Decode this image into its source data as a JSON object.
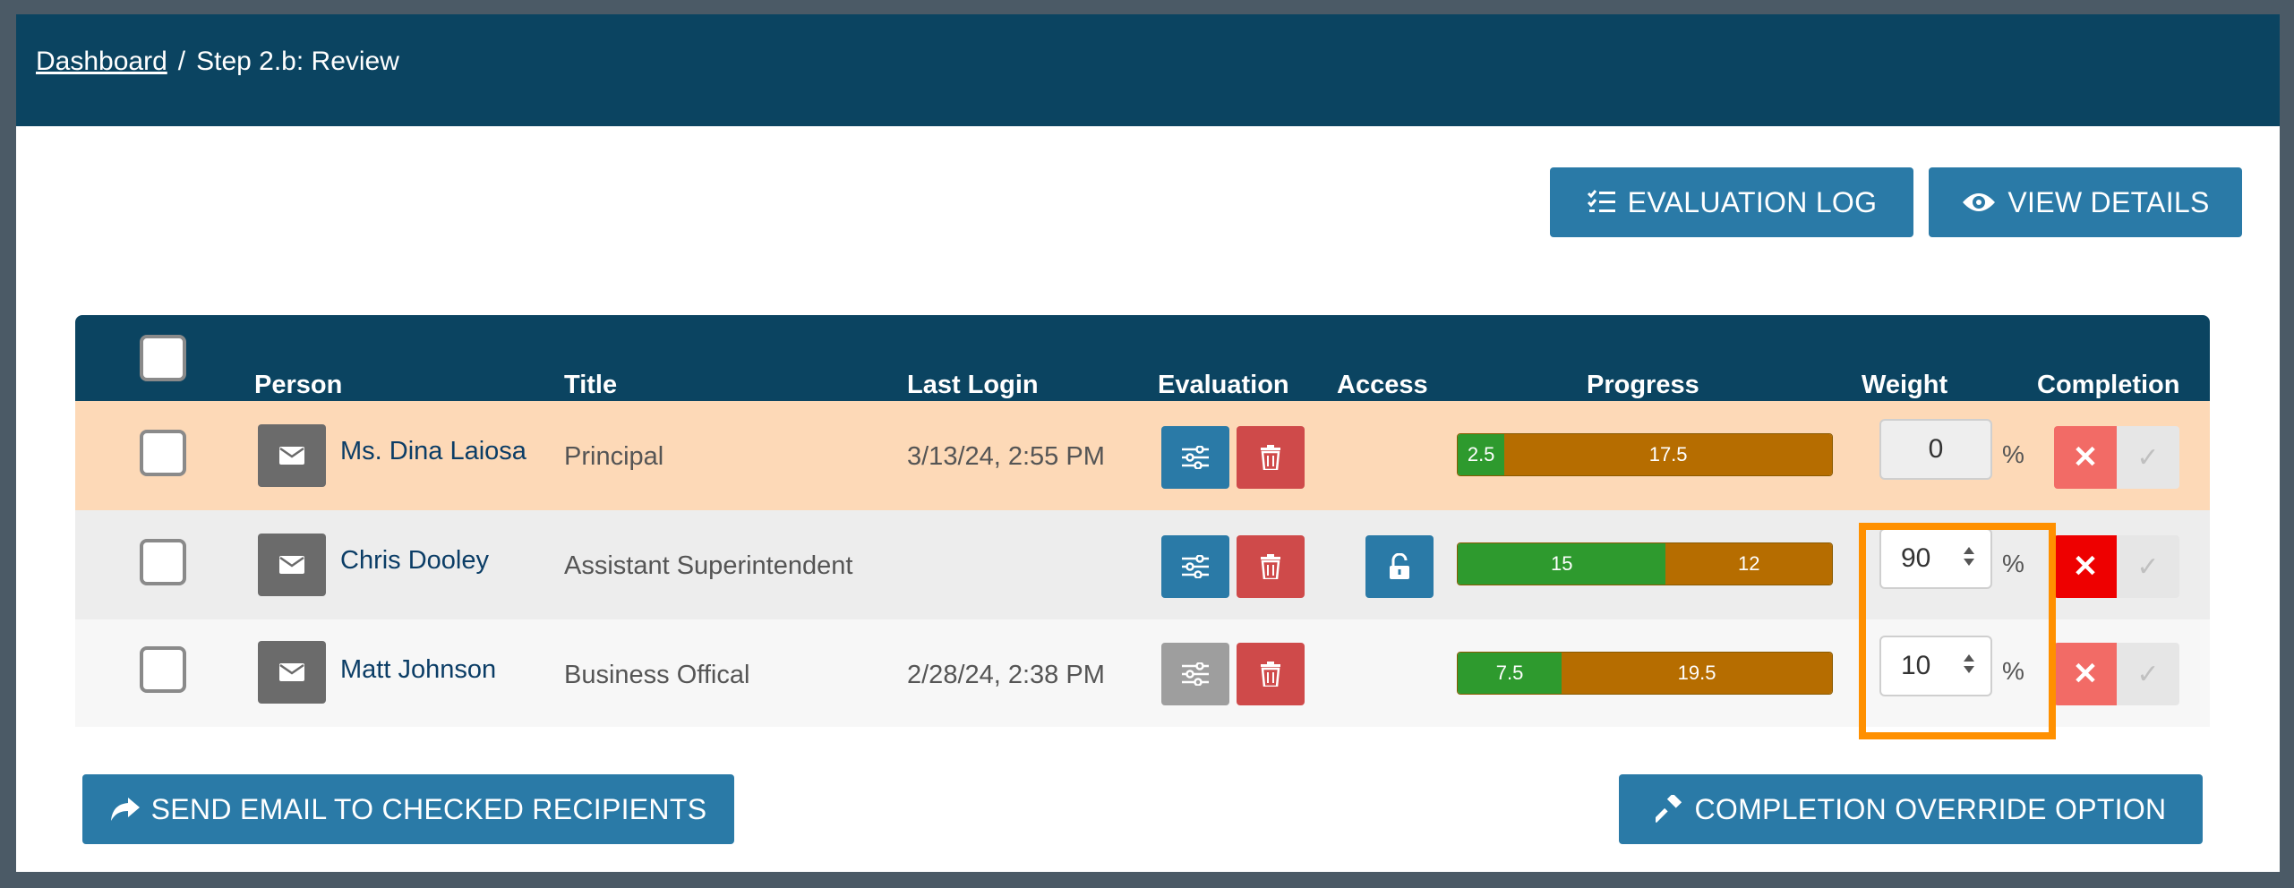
{
  "breadcrumb": {
    "home": "Dashboard",
    "separator": "/",
    "current": "Step 2.b: Review"
  },
  "toolbar": {
    "evaluation_log": "EVALUATION LOG",
    "view_details": "VIEW DETAILS"
  },
  "table": {
    "headers": {
      "person": "Person",
      "title": "Title",
      "last_login": "Last Login",
      "evaluation": "Evaluation",
      "access": "Access",
      "progress": "Progress",
      "weight": "Weight",
      "completion": "Completion"
    },
    "rows": [
      {
        "name": "Ms. Dina Laiosa",
        "title": "Principal",
        "last_login": "3/13/24, 2:55 PM",
        "progress": [
          "2.5",
          "17.5"
        ],
        "weight": "0",
        "pct": "%",
        "x": "✕",
        "ok": "✓"
      },
      {
        "name": "Chris Dooley",
        "title": "Assistant Superintendent",
        "last_login": "",
        "progress": [
          "15",
          "12"
        ],
        "weight": "90",
        "pct": "%",
        "x": "✕",
        "ok": "✓"
      },
      {
        "name": "Matt Johnson",
        "title": "Business Offical",
        "last_login": "2/28/24, 2:38 PM",
        "progress": [
          "7.5",
          "19.5"
        ],
        "weight": "10",
        "pct": "%",
        "x": "✕",
        "ok": "✓"
      }
    ]
  },
  "footer": {
    "send_email": "SEND EMAIL TO CHECKED RECIPIENTS",
    "completion_override": "COMPLETION OVERRIDE OPTION"
  },
  "colors": {
    "navy": "#0b4461",
    "button_blue": "#2a7aa7",
    "delete_red": "#cf4a4a",
    "highlight_orange": "#ff9000",
    "progress_green": "#2e9a2e",
    "progress_orange": "#b66d00"
  }
}
